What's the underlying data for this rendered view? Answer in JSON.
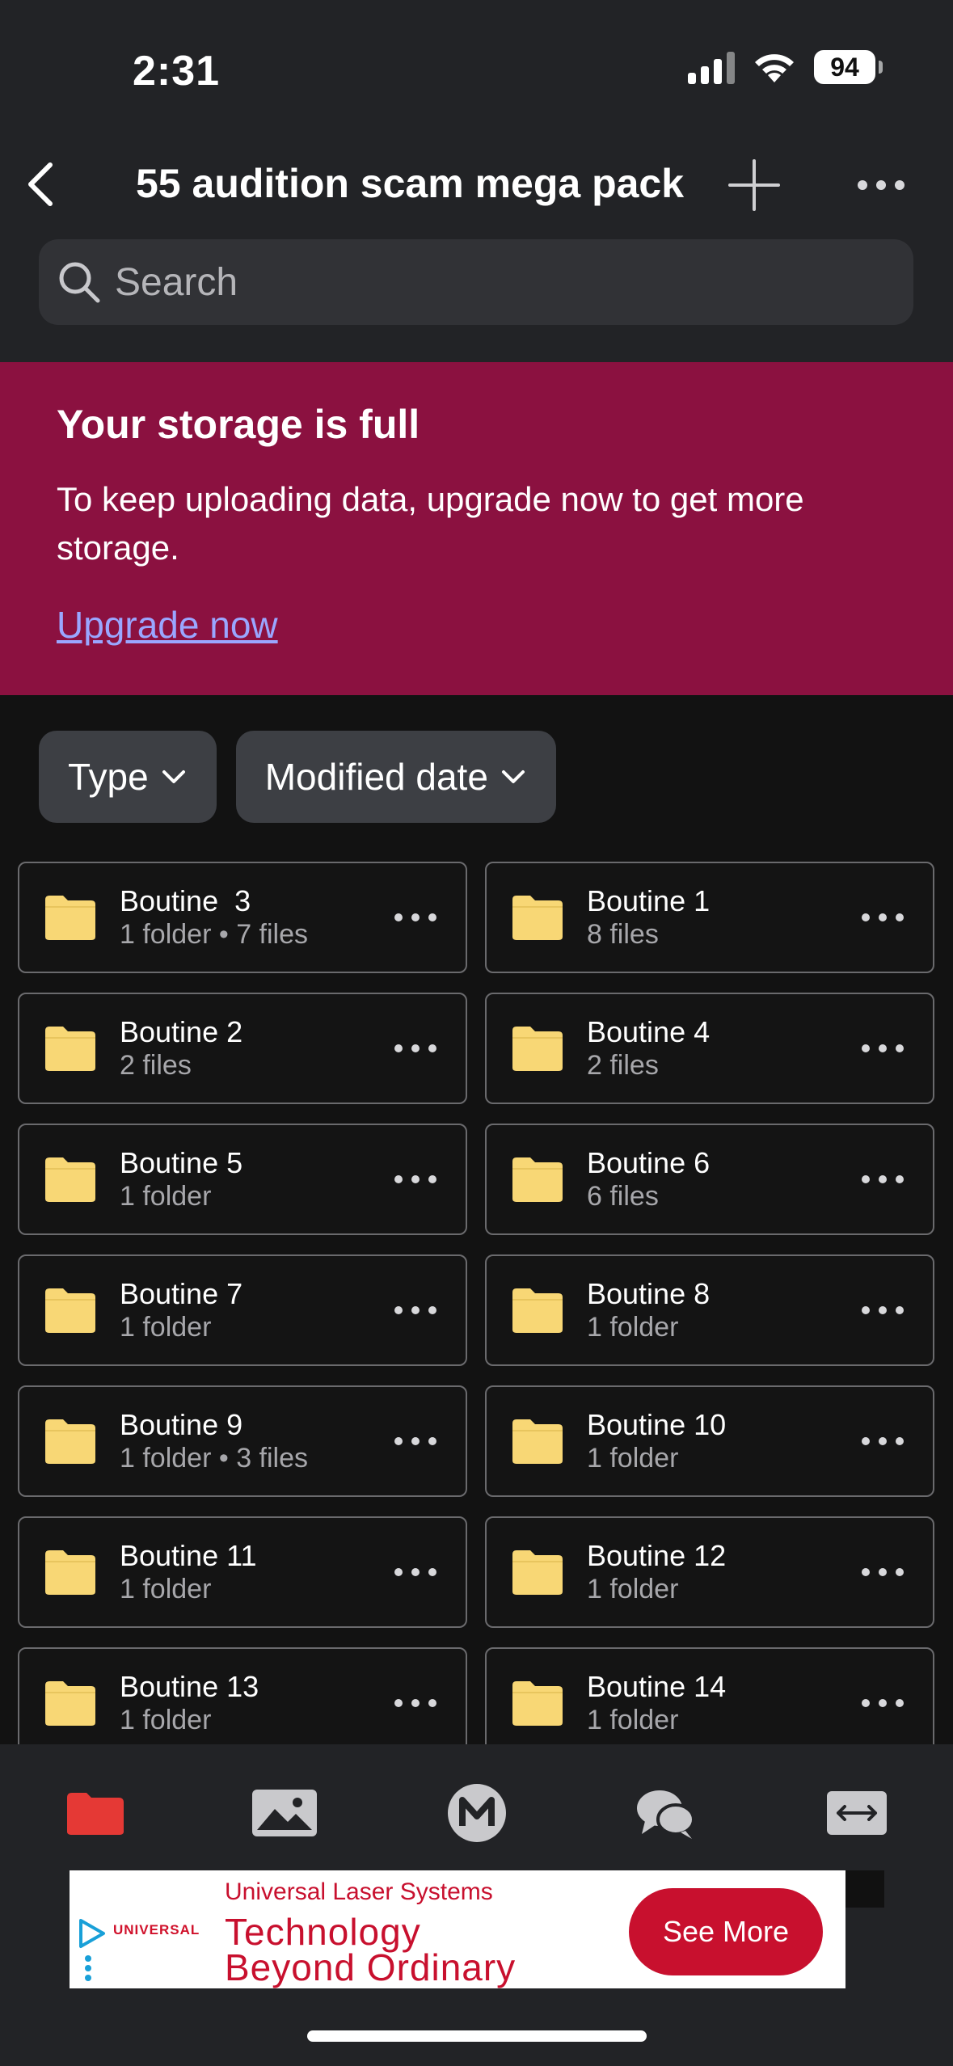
{
  "status_bar": {
    "time": "2:31",
    "battery": "94"
  },
  "nav": {
    "title": "55 audition scam mega pack"
  },
  "search": {
    "placeholder": "Search"
  },
  "banner": {
    "title": "Your storage is full",
    "text": "To keep uploading data, upgrade now to get more storage.",
    "link": "Upgrade now"
  },
  "filters": [
    {
      "label": "Type"
    },
    {
      "label": "Modified date"
    }
  ],
  "folders": [
    {
      "name": "Boutine  3",
      "meta": "1 folder • 7 files"
    },
    {
      "name": "Boutine 1",
      "meta": "8 files"
    },
    {
      "name": "Boutine 2",
      "meta": "2 files"
    },
    {
      "name": "Boutine 4",
      "meta": "2 files"
    },
    {
      "name": "Boutine 5",
      "meta": "1 folder"
    },
    {
      "name": "Boutine 6",
      "meta": "6 files"
    },
    {
      "name": "Boutine 7",
      "meta": "1 folder"
    },
    {
      "name": "Boutine 8",
      "meta": "1 folder"
    },
    {
      "name": "Boutine 9",
      "meta": "1 folder • 3 files"
    },
    {
      "name": "Boutine 10",
      "meta": "1 folder"
    },
    {
      "name": "Boutine 11",
      "meta": "1 folder"
    },
    {
      "name": "Boutine 12",
      "meta": "1 folder"
    },
    {
      "name": "Boutine 13",
      "meta": "1 folder"
    },
    {
      "name": "Boutine 14",
      "meta": "1 folder"
    }
  ],
  "tabs": [
    {
      "icon": "folder-icon",
      "active": true
    },
    {
      "icon": "photos-icon",
      "active": false
    },
    {
      "icon": "mega-logo-icon",
      "active": false
    },
    {
      "icon": "chat-icon",
      "active": false
    },
    {
      "icon": "transfers-icon",
      "active": false
    }
  ],
  "ad": {
    "brand": "Universal Laser Systems",
    "logo": "UNIVERSAL",
    "headline_line1": "Technology",
    "headline_line2": "Beyond Ordinary",
    "cta": "See More"
  },
  "colors": {
    "background": "#121212",
    "header": "#222326",
    "banner": "#8b1140",
    "link": "#9aa6ff",
    "folder": "#f8d775",
    "active_tab": "#e53935",
    "ad_red": "#c8102e"
  }
}
